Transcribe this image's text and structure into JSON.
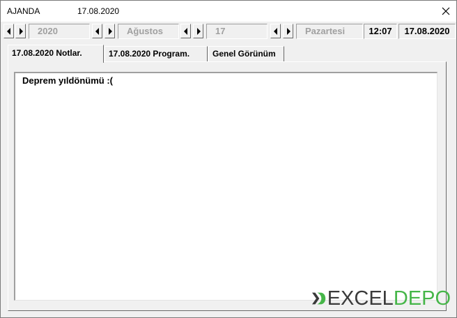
{
  "window": {
    "title": "AJANDA",
    "title_date": "17.08.2020"
  },
  "toolbar": {
    "year": "2020",
    "month": "Ağustos",
    "day": "17",
    "weekday": "Pazartesi",
    "time": "12:07",
    "date": "17.08.2020"
  },
  "tabs": [
    {
      "label": "17.08.2020  Notlar.",
      "active": true
    },
    {
      "label": "17.08.2020  Program.",
      "active": false
    },
    {
      "label": "Genel Görünüm",
      "active": false
    }
  ],
  "notes": {
    "text": "Deprem yıldönümü :("
  },
  "logo": {
    "part1": "EXCEL",
    "part2": "DEPO",
    "colors": {
      "dark": "#3a3a3a",
      "green": "#46b649"
    }
  },
  "icons": {
    "close": "close-icon",
    "left": "arrow-left-icon",
    "right": "arrow-right-icon",
    "logo_mark": "excel-x-logo-icon"
  }
}
